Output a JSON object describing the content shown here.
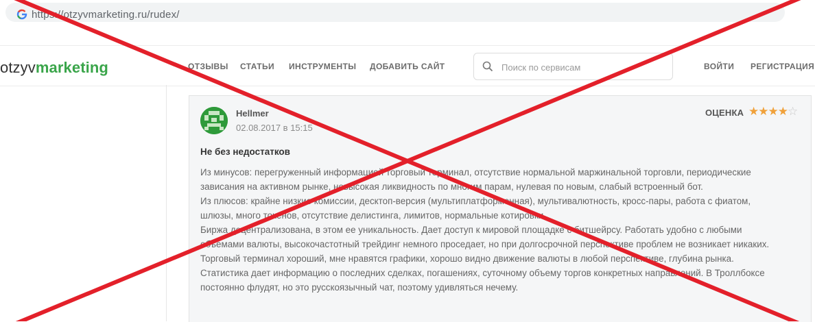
{
  "browser": {
    "url": "https://otzyvmarketing.ru/rudex/"
  },
  "header": {
    "logo_part1": "otzyv",
    "logo_part2": "marketing",
    "nav": [
      "ОТЗЫВЫ",
      "СТАТЬИ",
      "ИНСТРУМЕНТЫ",
      "ДОБАВИТЬ САЙТ"
    ],
    "search_placeholder": "Поиск по сервисам",
    "login": "ВОЙТИ",
    "register": "РЕГИСТРАЦИЯ"
  },
  "review": {
    "author": "Hellmer",
    "date": "02.08.2017 в 15:15",
    "rating_label": "ОЦЕНКА",
    "rating": 4,
    "rating_max": 5,
    "title": "Не без недостатков",
    "lines": [
      "Из минусов: перегруженный информацией торговый терминал, отсутствие нормальной маржинальной торговли, периодические",
      "зависания на активном рынке, невысокая ликвидность по многим парам, нулевая по новым, слабый встроенный бот.",
      "Из плюсов: крайне низкие комиссии, десктоп-версия (мультиплатформенная), мультивалютность, кросс-пары, работа с фиатом,",
      "шлюзы, много токенов, отсутствие делистинга, лимитов, нормальные котировки.",
      "Биржа децентрализована, в этом ее уникальность. Дает доступ к мировой площадке с битшейрсу. Работать удобно с любыми",
      "объемами валюты, высокочастотный трейдинг немного проседает, но при долгосрочной перспективе проблем не возникает никаких.",
      "Торговый терминал хороший, мне нравятся графики, хорошо видно движение валюты в любой перспективе, глубина рынка.",
      "Статистика дает информацию о последних сделках, погашениях, суточному объему торгов конкретных направлений. В Троллбоксе",
      "постоянно флудят, но это русскоязычный чат, поэтому удивляться нечему."
    ]
  },
  "overlay": {
    "color": "#e3202a"
  }
}
